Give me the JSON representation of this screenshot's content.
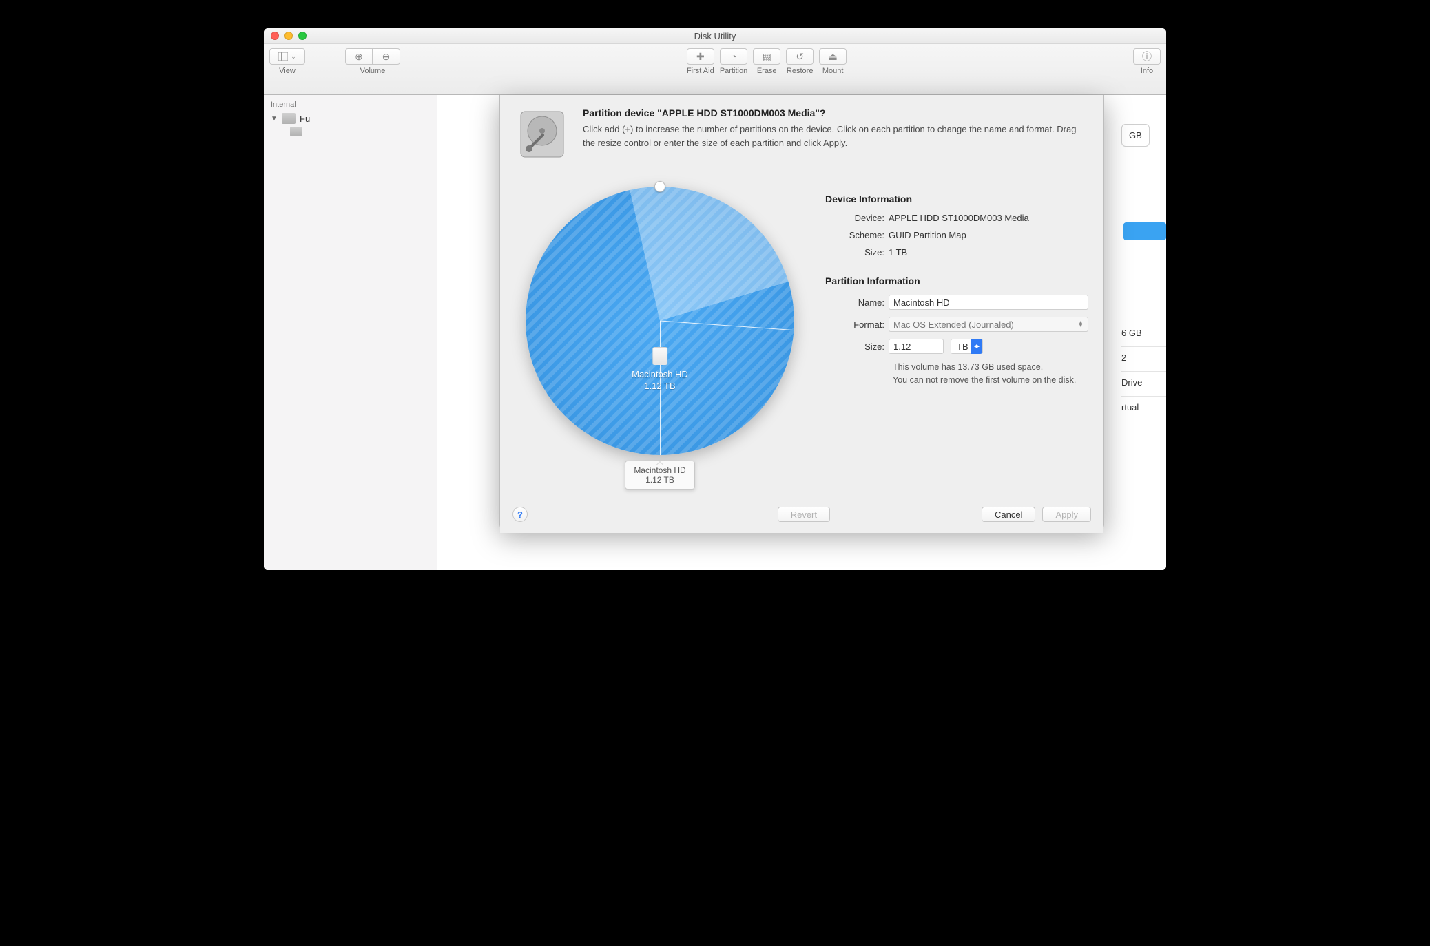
{
  "window": {
    "title": "Disk Utility"
  },
  "toolbar": {
    "view": "View",
    "volume": "Volume",
    "first_aid": "First Aid",
    "partition": "Partition",
    "erase": "Erase",
    "restore": "Restore",
    "mount": "Mount",
    "info": "Info"
  },
  "sidebar": {
    "section": "Internal",
    "items": [
      {
        "label": "Fu"
      },
      {
        "label": ""
      }
    ]
  },
  "sheet": {
    "title": "Partition device \"APPLE HDD ST1000DM003 Media\"?",
    "desc": "Click add (+) to increase the number of partitions on the device. Click on each partition to change the name and format. Drag the resize control or enter the size of each partition and click Apply.",
    "device_info_h": "Device Information",
    "device_label": "Device:",
    "device_value": "APPLE HDD ST1000DM003 Media",
    "scheme_label": "Scheme:",
    "scheme_value": "GUID Partition Map",
    "dsize_label": "Size:",
    "dsize_value": "1 TB",
    "partition_info_h": "Partition Information",
    "name_label": "Name:",
    "name_value": "Macintosh HD",
    "format_label": "Format:",
    "format_value": "Mac OS Extended (Journaled)",
    "psize_label": "Size:",
    "psize_value": "1.12",
    "psize_unit": "TB",
    "note1": "This volume has 13.73 GB used space.",
    "note2": "You can not remove the first volume on the disk.",
    "tooltip_name": "Macintosh HD",
    "tooltip_size": "1.12 TB",
    "pie_name": "Macintosh HD",
    "pie_size": "1.12 TB",
    "buttons": {
      "help": "?",
      "revert": "Revert",
      "cancel": "Cancel",
      "apply": "Apply"
    }
  },
  "bg": {
    "pill": "GB",
    "row1": "6 GB",
    "row2": "2",
    "row3": "Drive",
    "row4": "rtual"
  },
  "chart_data": {
    "type": "pie",
    "title": "",
    "slices": [
      {
        "name": "Macintosh HD",
        "value": 1.12,
        "unit": "TB",
        "fraction": 1.0
      }
    ],
    "handle_angle_deg": 0,
    "wedge_highlight_deg": 86
  }
}
